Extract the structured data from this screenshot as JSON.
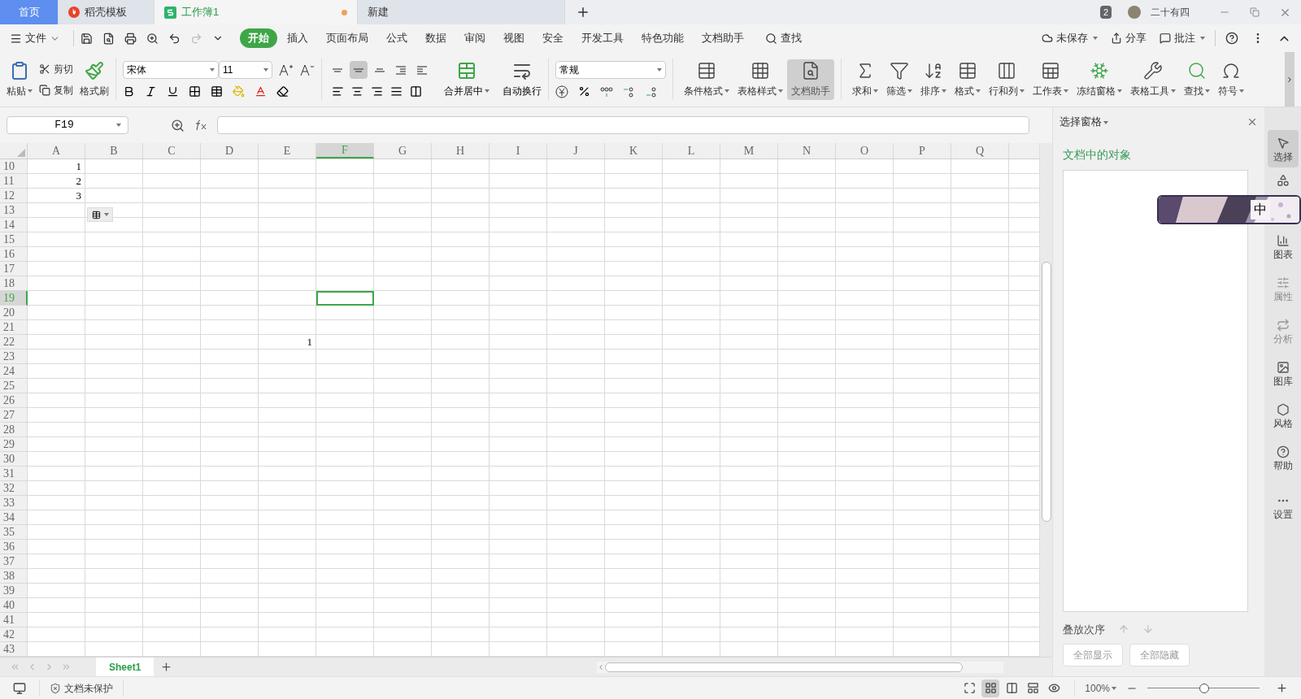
{
  "tabs": [
    {
      "label": "首页",
      "kind": "home",
      "selected": false,
      "unsaved": false
    },
    {
      "label": "稻壳模板",
      "kind": "docer",
      "selected": false,
      "unsaved": false
    },
    {
      "label": "工作簿1",
      "kind": "sheet",
      "selected": true,
      "unsaved": true
    },
    {
      "label": "新建",
      "kind": "new",
      "selected": false,
      "unsaved": false
    }
  ],
  "title_bar": {
    "badge": "2",
    "user": "二十有四"
  },
  "menu": {
    "file": "文件",
    "search": "查找",
    "tabs": [
      {
        "label": "开始",
        "selected": true
      },
      {
        "label": "插入",
        "selected": false
      },
      {
        "label": "页面布局",
        "selected": false
      },
      {
        "label": "公式",
        "selected": false
      },
      {
        "label": "数据",
        "selected": false
      },
      {
        "label": "审阅",
        "selected": false
      },
      {
        "label": "视图",
        "selected": false
      },
      {
        "label": "安全",
        "selected": false
      },
      {
        "label": "开发工具",
        "selected": false
      },
      {
        "label": "特色功能",
        "selected": false
      },
      {
        "label": "文档助手",
        "selected": false
      }
    ],
    "actions": [
      {
        "label": "未保存",
        "kind": "cloud"
      },
      {
        "label": "分享",
        "kind": "share"
      },
      {
        "label": "批注",
        "kind": "comment"
      }
    ]
  },
  "ribbon": {
    "paste": "粘贴",
    "cut": "剪切",
    "copy": "复制",
    "painter": "格式刷",
    "font_name": "宋体",
    "font_size": "11",
    "align_row": [
      {
        "kind": "top",
        "selected": false
      },
      {
        "kind": "middle",
        "selected": true
      },
      {
        "kind": "bottom",
        "selected": false
      },
      {
        "kind": "outdent",
        "selected": false
      },
      {
        "kind": "indent",
        "selected": false
      }
    ],
    "merge": "合并居中",
    "wrap": "自动换行",
    "number_format": "常规",
    "tools": [
      {
        "label": "条件格式",
        "kind": "cond",
        "selected": false
      },
      {
        "label": "表格样式",
        "kind": "style",
        "selected": false
      },
      {
        "label": "文档助手",
        "kind": "assistant",
        "selected": true
      },
      {
        "label": "求和",
        "kind": "sum",
        "selected": false
      },
      {
        "label": "筛选",
        "kind": "filter",
        "selected": false
      },
      {
        "label": "排序",
        "kind": "sort",
        "selected": false
      },
      {
        "label": "格式",
        "kind": "format",
        "selected": false
      },
      {
        "label": "行和列",
        "kind": "rowcol",
        "selected": false
      },
      {
        "label": "工作表",
        "kind": "sheet",
        "selected": false
      },
      {
        "label": "冻结窗格",
        "kind": "freeze",
        "selected": false
      },
      {
        "label": "表格工具",
        "kind": "tools",
        "selected": false
      },
      {
        "label": "查找",
        "kind": "find",
        "selected": false
      },
      {
        "label": "符号",
        "kind": "symbol",
        "selected": false
      }
    ]
  },
  "formula_bar": {
    "name_box": "F19"
  },
  "grid": {
    "columns": [
      {
        "label": "A",
        "selected": false
      },
      {
        "label": "B",
        "selected": false
      },
      {
        "label": "C",
        "selected": false
      },
      {
        "label": "D",
        "selected": false
      },
      {
        "label": "E",
        "selected": false
      },
      {
        "label": "F",
        "selected": true
      },
      {
        "label": "G",
        "selected": false
      },
      {
        "label": "H",
        "selected": false
      },
      {
        "label": "I",
        "selected": false
      },
      {
        "label": "J",
        "selected": false
      },
      {
        "label": "K",
        "selected": false
      },
      {
        "label": "L",
        "selected": false
      },
      {
        "label": "M",
        "selected": false
      },
      {
        "label": "N",
        "selected": false
      },
      {
        "label": "O",
        "selected": false
      },
      {
        "label": "P",
        "selected": false
      },
      {
        "label": "Q",
        "selected": false
      }
    ],
    "rows": [
      {
        "label": "10",
        "selected": false,
        "cells": {
          "A": "1"
        }
      },
      {
        "label": "11",
        "selected": false,
        "cells": {
          "A": "2"
        }
      },
      {
        "label": "12",
        "selected": false,
        "cells": {
          "A": "3"
        }
      },
      {
        "label": "13",
        "selected": false
      },
      {
        "label": "14",
        "selected": false
      },
      {
        "label": "15",
        "selected": false
      },
      {
        "label": "16",
        "selected": false
      },
      {
        "label": "17",
        "selected": false
      },
      {
        "label": "18",
        "selected": false
      },
      {
        "label": "19",
        "selected": true
      },
      {
        "label": "20",
        "selected": false
      },
      {
        "label": "21",
        "selected": false
      },
      {
        "label": "22",
        "selected": false,
        "cells": {
          "E": "1"
        }
      },
      {
        "label": "23",
        "selected": false
      },
      {
        "label": "24",
        "selected": false
      },
      {
        "label": "25",
        "selected": false
      },
      {
        "label": "26",
        "selected": false
      },
      {
        "label": "27",
        "selected": false
      },
      {
        "label": "28",
        "selected": false
      },
      {
        "label": "29",
        "selected": false
      },
      {
        "label": "30",
        "selected": false
      },
      {
        "label": "31",
        "selected": false
      },
      {
        "label": "32",
        "selected": false
      },
      {
        "label": "33",
        "selected": false
      },
      {
        "label": "34",
        "selected": false
      },
      {
        "label": "35",
        "selected": false
      },
      {
        "label": "36",
        "selected": false
      },
      {
        "label": "37",
        "selected": false
      },
      {
        "label": "38",
        "selected": false
      },
      {
        "label": "39",
        "selected": false
      },
      {
        "label": "40",
        "selected": false
      },
      {
        "label": "41",
        "selected": false
      },
      {
        "label": "42",
        "selected": false
      },
      {
        "label": "43",
        "selected": false
      }
    ]
  },
  "sheets": [
    {
      "label": "Sheet1",
      "selected": true
    }
  ],
  "selection_pane": {
    "title": "选择窗格",
    "heading": "文档中的对象",
    "order_label": "叠放次序",
    "buttons": [
      {
        "label": "全部显示",
        "disabled": true
      },
      {
        "label": "全部隐藏",
        "disabled": true
      }
    ]
  },
  "sidebar": [
    {
      "label": "选择",
      "kind": "select",
      "selected": true,
      "disabled": false
    },
    {
      "kind": "shape",
      "selected": false,
      "disabled": false
    },
    {
      "label": "图表",
      "kind": "chart",
      "selected": false,
      "disabled": false
    },
    {
      "label": "属性",
      "kind": "props",
      "selected": false,
      "disabled": true
    },
    {
      "label": "分析",
      "kind": "analysis",
      "selected": false,
      "disabled": true
    },
    {
      "label": "图库",
      "kind": "gallery",
      "selected": false,
      "disabled": false
    },
    {
      "label": "风格",
      "kind": "style",
      "selected": false,
      "disabled": false
    },
    {
      "label": "帮助",
      "kind": "help",
      "selected": false,
      "disabled": false
    },
    {
      "label": "设置",
      "kind": "settings",
      "selected": false,
      "disabled": false
    }
  ],
  "ime_toolbar": {
    "mode": "中"
  },
  "status_bar": {
    "protection": "文档未保护",
    "zoom": "100%",
    "zoom_slider": {
      "level": 0.51
    },
    "views": [
      {
        "kind": "fullscreen",
        "selected": false
      },
      {
        "kind": "normal",
        "selected": true
      },
      {
        "kind": "pagebreak",
        "selected": false
      },
      {
        "kind": "layout",
        "selected": false
      },
      {
        "kind": "eye",
        "selected": false
      }
    ]
  }
}
